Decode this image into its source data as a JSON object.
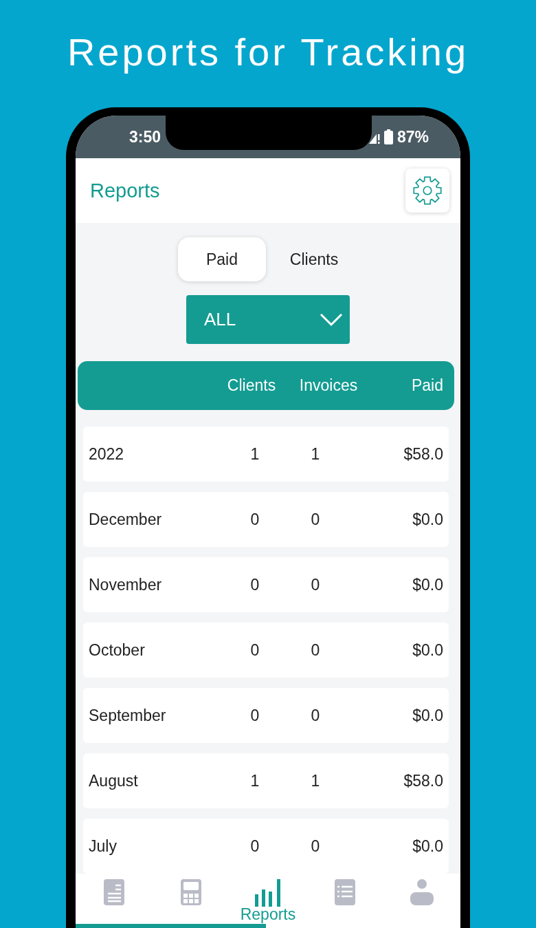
{
  "headline": "Reports for Tracking",
  "status_bar": {
    "time": "3:50",
    "battery": "87%"
  },
  "header": {
    "title": "Reports"
  },
  "tabs": [
    {
      "label": "Paid",
      "selected": true
    },
    {
      "label": "Clients",
      "selected": false
    }
  ],
  "filter": {
    "value": "ALL"
  },
  "table": {
    "columns": [
      "Clients",
      "Invoices",
      "Paid"
    ],
    "rows": [
      {
        "period": "2022",
        "clients": "1",
        "invoices": "1",
        "paid": "$58.0"
      },
      {
        "period": "December",
        "clients": "0",
        "invoices": "0",
        "paid": "$0.0"
      },
      {
        "period": "November",
        "clients": "0",
        "invoices": "0",
        "paid": "$0.0"
      },
      {
        "period": "October",
        "clients": "0",
        "invoices": "0",
        "paid": "$0.0"
      },
      {
        "period": "September",
        "clients": "0",
        "invoices": "0",
        "paid": "$0.0"
      },
      {
        "period": "August",
        "clients": "1",
        "invoices": "1",
        "paid": "$58.0"
      },
      {
        "period": "July",
        "clients": "0",
        "invoices": "0",
        "paid": "$0.0"
      }
    ]
  },
  "bottom_nav": [
    {
      "kind": "document",
      "selected": false
    },
    {
      "kind": "calculator",
      "selected": false
    },
    {
      "kind": "chart",
      "selected": true,
      "label": "Reports"
    },
    {
      "kind": "list",
      "selected": false
    },
    {
      "kind": "person",
      "selected": false
    }
  ]
}
